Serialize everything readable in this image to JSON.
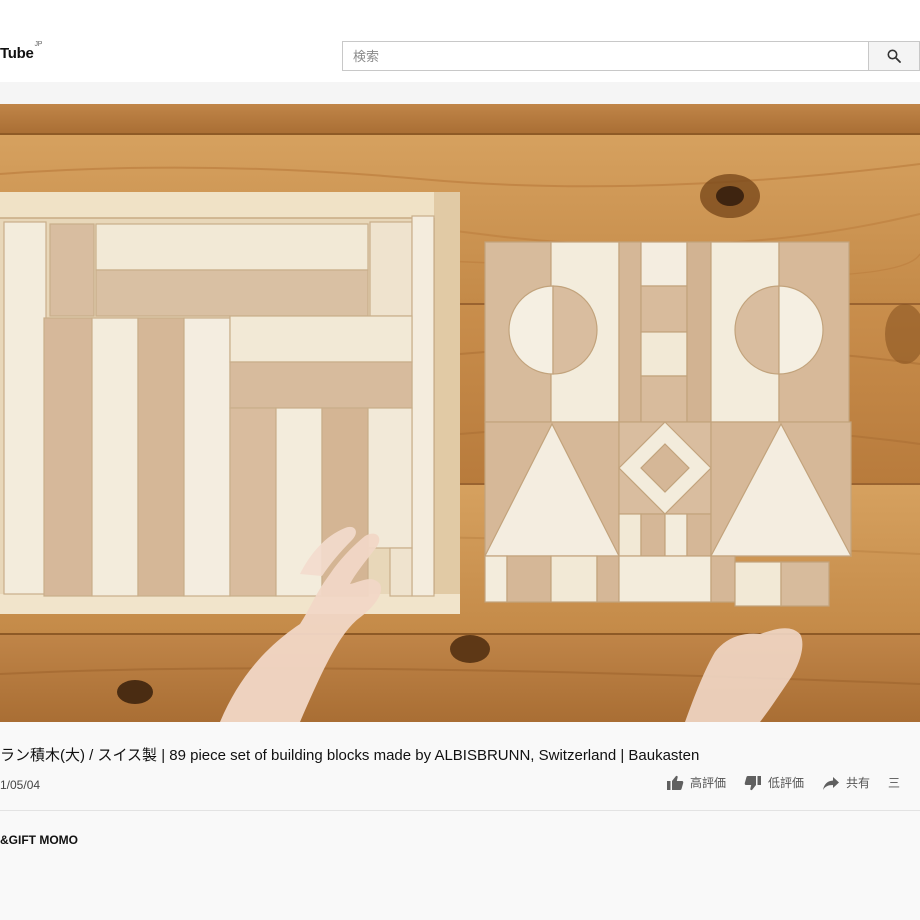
{
  "masthead": {
    "logo_text": "Tube",
    "logo_region": "JP",
    "search_placeholder": "検索"
  },
  "video": {
    "title": "ラン積木(大) / スイス製 | 89 piece set of building blocks made by ALBISBRUNN, Switzerland | Baukasten",
    "date": "1/05/04",
    "channel": "&GIFT MOMO"
  },
  "actions": {
    "like_label": "高評価",
    "dislike_label": "低評価",
    "share_label": "共有",
    "more_label": "三"
  },
  "colors": {
    "table_wood": "#c9924e",
    "birch": "#efe6d4",
    "beech": "#d4b89a",
    "icon_gray": "#606060"
  },
  "icons": {
    "search": "search-icon",
    "like": "thumbs-up-icon",
    "dislike": "thumbs-down-icon",
    "share": "share-arrow-icon",
    "more": "more-icon"
  }
}
